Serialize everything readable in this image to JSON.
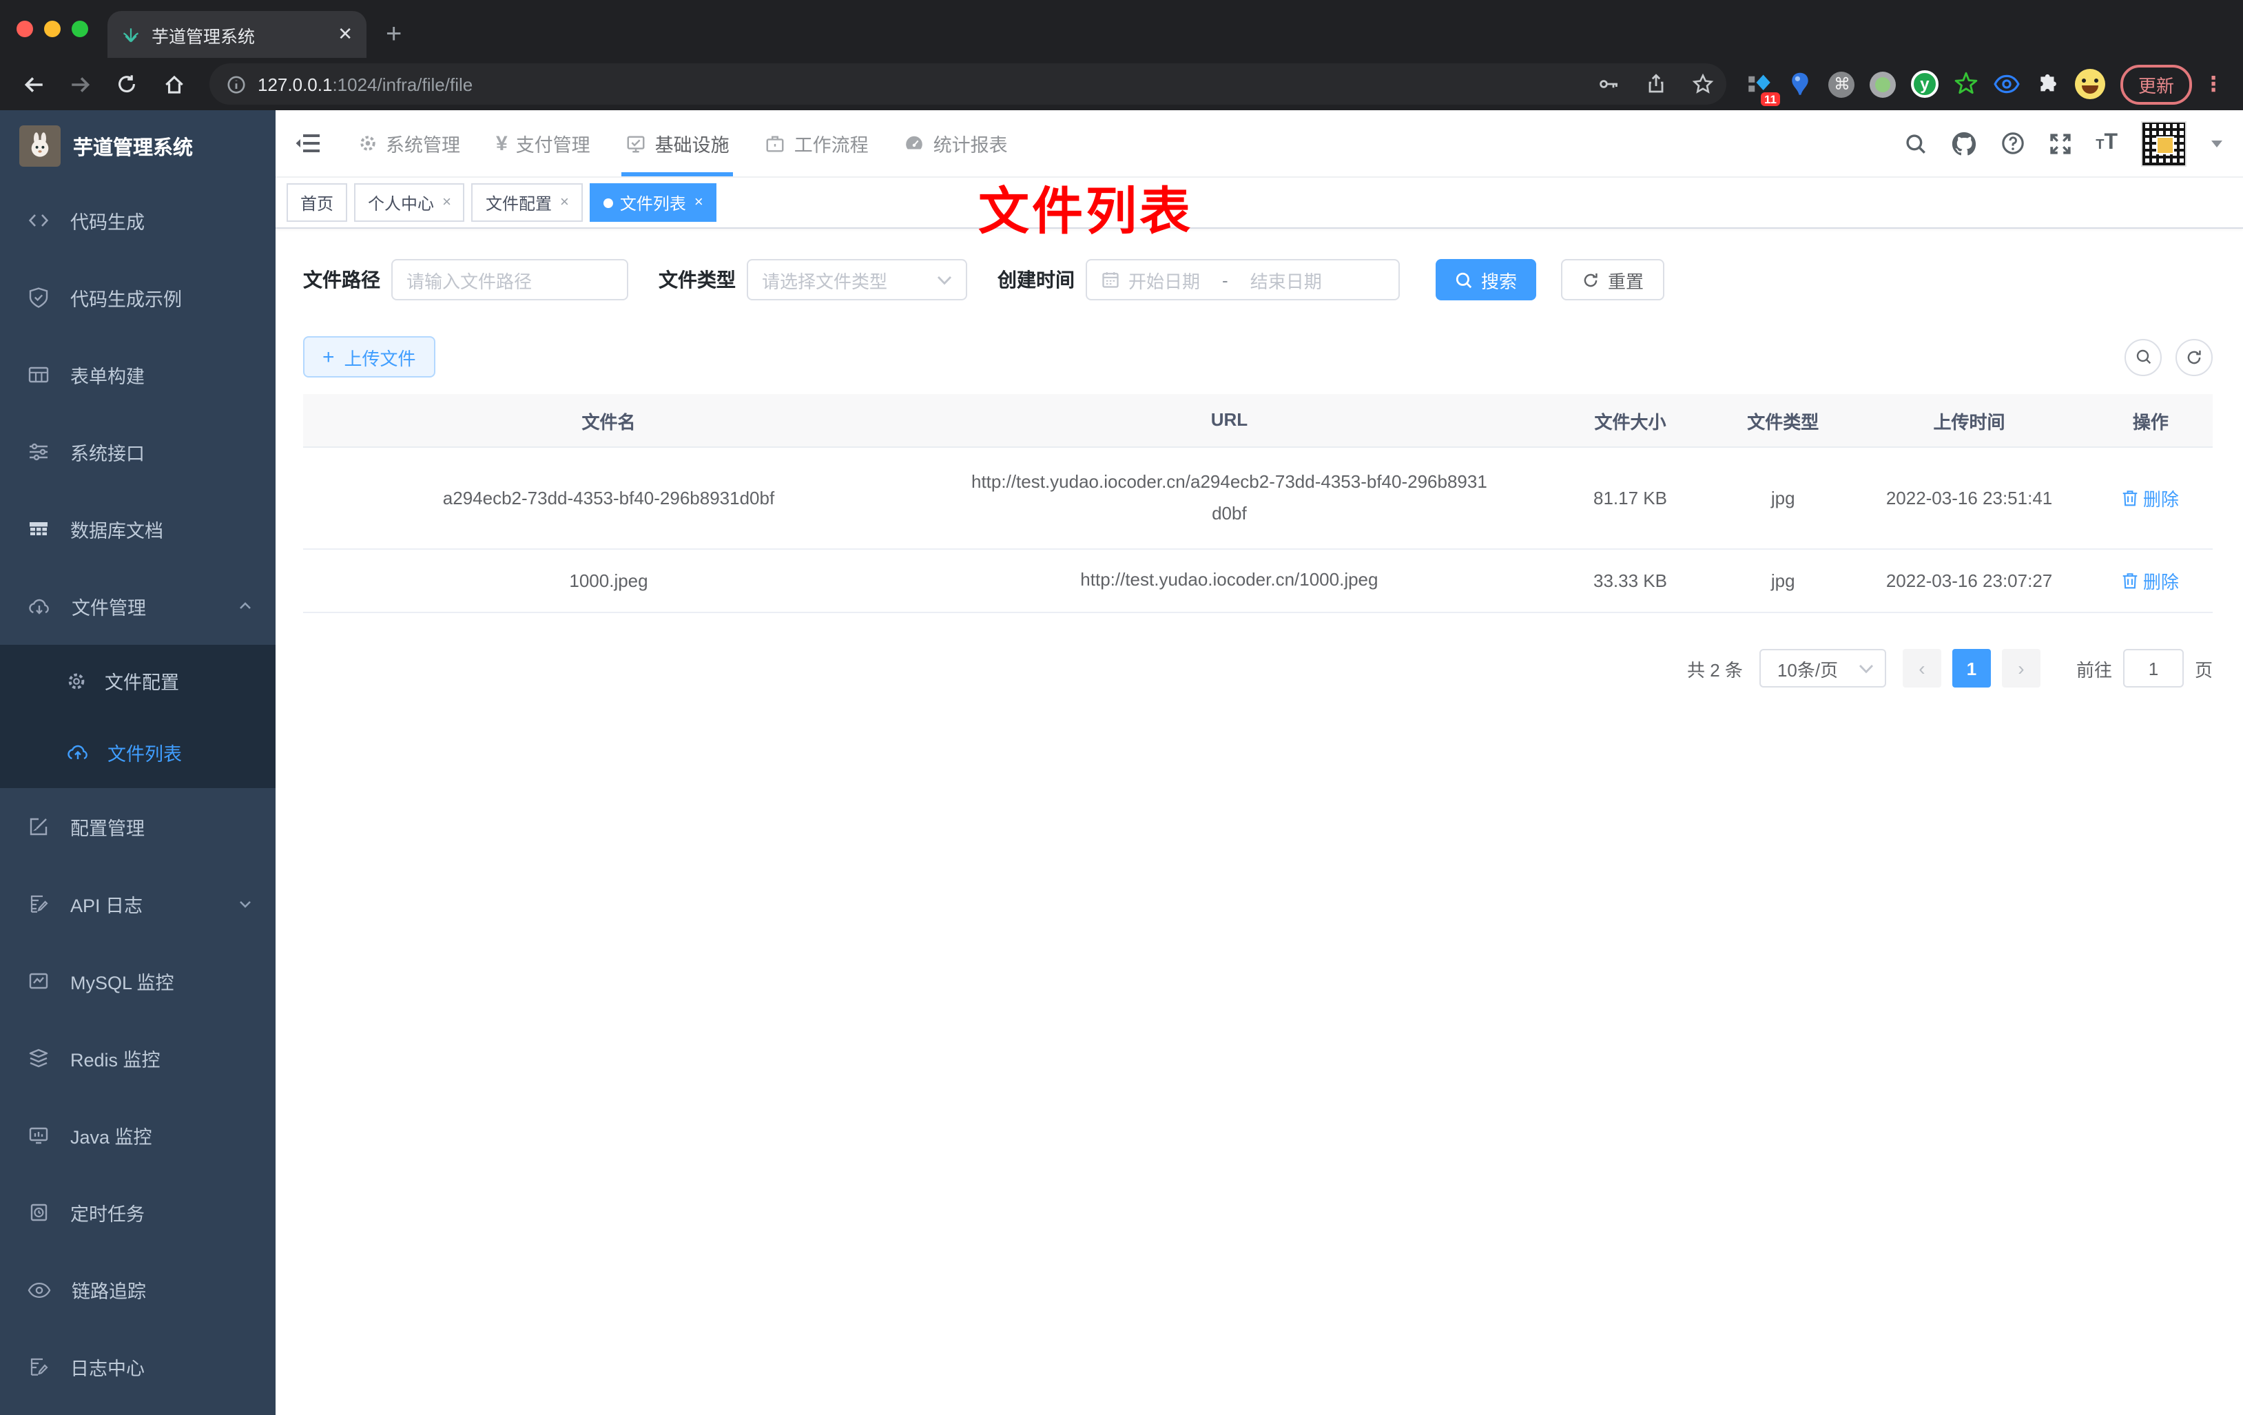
{
  "browser": {
    "tab_title": "芋道管理系统",
    "new_tab": "+",
    "url_host": "127.0.0.1",
    "url_path": ":1024/infra/file/file",
    "extension_badge": "11",
    "cmd_glyph": "⌘",
    "y_glyph": "y",
    "update_label": "更新",
    "menu_dots": "⋮",
    "tab_close": "✕"
  },
  "sidebar": {
    "logo_title": "芋道管理系统",
    "items": [
      {
        "label": "代码生成"
      },
      {
        "label": "代码生成示例"
      },
      {
        "label": "表单构建"
      },
      {
        "label": "系统接口"
      },
      {
        "label": "数据库文档"
      },
      {
        "label": "文件管理"
      },
      {
        "label": "文件配置"
      },
      {
        "label": "文件列表"
      },
      {
        "label": "配置管理"
      },
      {
        "label": "API 日志"
      },
      {
        "label": "MySQL 监控"
      },
      {
        "label": "Redis 监控"
      },
      {
        "label": "Java 监控"
      },
      {
        "label": "定时任务"
      },
      {
        "label": "链路追踪"
      },
      {
        "label": "日志中心"
      }
    ]
  },
  "topnav": {
    "items": [
      {
        "label": "系统管理"
      },
      {
        "label": "支付管理"
      },
      {
        "label": "基础设施"
      },
      {
        "label": "工作流程"
      },
      {
        "label": "统计报表"
      }
    ],
    "font_icon_small": "T",
    "font_icon_big": "T"
  },
  "tags": {
    "items": [
      {
        "label": "首页"
      },
      {
        "label": "个人中心"
      },
      {
        "label": "文件配置"
      },
      {
        "label": "文件列表"
      }
    ],
    "close_glyph": "×"
  },
  "annotation": {
    "text": "文件列表",
    "color": "#ff0000"
  },
  "filters": {
    "path_label": "文件路径",
    "path_placeholder": "请输入文件路径",
    "type_label": "文件类型",
    "type_placeholder": "请选择文件类型",
    "time_label": "创建时间",
    "start_placeholder": "开始日期",
    "range_separator": "-",
    "end_placeholder": "结束日期",
    "search_label": "搜索",
    "reset_label": "重置"
  },
  "toolbar": {
    "upload_label": "上传文件",
    "upload_plus": "+"
  },
  "table": {
    "headers": [
      "文件名",
      "URL",
      "文件大小",
      "文件类型",
      "上传时间",
      "操作"
    ],
    "rows": [
      {
        "name": "a294ecb2-73dd-4353-bf40-296b8931d0bf",
        "url": "http://test.yudao.iocoder.cn/a294ecb2-73dd-4353-bf40-296b8931d0bf",
        "size": "81.17 KB",
        "type": "jpg",
        "time": "2022-03-16 23:51:41",
        "action": "删除"
      },
      {
        "name": "1000.jpeg",
        "url": "http://test.yudao.iocoder.cn/1000.jpeg",
        "size": "33.33 KB",
        "type": "jpg",
        "time": "2022-03-16 23:07:27",
        "action": "删除"
      }
    ]
  },
  "pagination": {
    "total": "共 2 条",
    "page_size": "10条/页",
    "prev": "‹",
    "next": "›",
    "current_page": "1",
    "goto_label": "前往",
    "goto_value": "1",
    "page_unit": "页"
  },
  "colors": {
    "accent": "#409eff",
    "sidebar_bg": "#304156",
    "submenu_bg": "#1f2d3d",
    "annotation": "#ff0000"
  }
}
